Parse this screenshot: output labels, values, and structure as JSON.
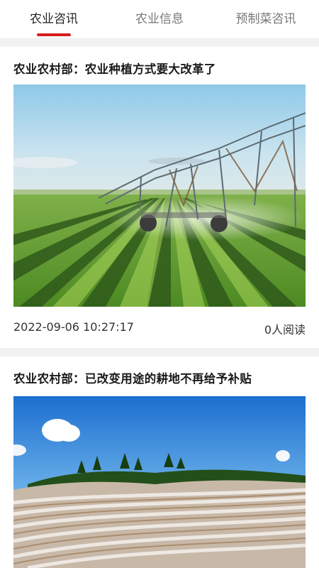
{
  "tabs": [
    {
      "label": "农业咨讯",
      "active": true
    },
    {
      "label": "农业信息",
      "active": false
    },
    {
      "label": "预制菜咨讯",
      "active": false
    }
  ],
  "accent_color": "#d81e1e",
  "articles": [
    {
      "title": "农业农村部：农业种植方式要大改革了",
      "image": "irrigation-field-photo",
      "date": "2022-09-06 10:27:17",
      "reads": "0人阅读"
    },
    {
      "title": "农业农村部：已改变用途的耕地不再给予补贴",
      "image": "plastic-mulch-field-photo"
    }
  ]
}
